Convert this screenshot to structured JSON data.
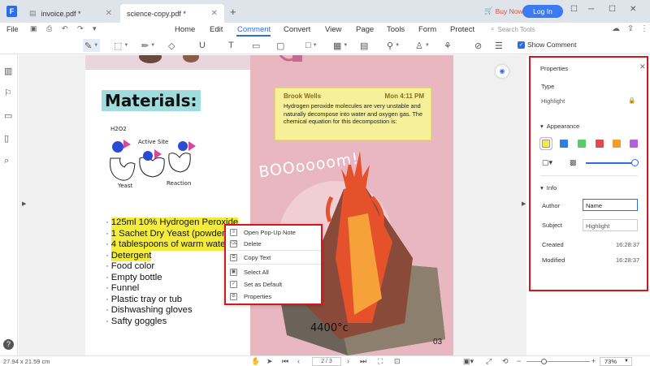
{
  "app": {
    "logo_glyph": "F"
  },
  "tabs": [
    {
      "label": "invoice.pdf *",
      "active": false
    },
    {
      "label": "science-copy.pdf *",
      "active": true
    }
  ],
  "header": {
    "buy_now": "Buy Now",
    "login": "Log In"
  },
  "menu": {
    "file": "File",
    "items": [
      "Home",
      "Edit",
      "Comment",
      "Convert",
      "View",
      "Page",
      "Tools",
      "Form",
      "Protect"
    ],
    "active": "Comment",
    "search_placeholder": "Search Tools"
  },
  "toolbar": {
    "show_comment": "Show Comment",
    "show_comment_checked": true
  },
  "document": {
    "heading": "Materials:",
    "diagram_labels": {
      "h2o2": "H2O2",
      "active_site": "Active Site",
      "yeast": "Yeast",
      "reaction": "Reaction"
    },
    "bullets": [
      {
        "text": "125ml 10% Hydrogen Peroxide",
        "highlighted": true
      },
      {
        "text": "1 Sachet Dry Yeast (powder)",
        "highlighted": true
      },
      {
        "text": "4 tablespoons of warm water",
        "highlighted": true
      },
      {
        "text": "Detergent",
        "highlighted": true
      },
      {
        "text": "Food color",
        "highlighted": false
      },
      {
        "text": "Empty bottle",
        "highlighted": false
      },
      {
        "text": "Funnel",
        "highlighted": false
      },
      {
        "text": "Plastic tray or tub",
        "highlighted": false
      },
      {
        "text": "Dishwashing gloves",
        "highlighted": false
      },
      {
        "text": "Safty goggles",
        "highlighted": false
      }
    ],
    "boom_text": "BOOoooom!",
    "temperature": "4400°c",
    "page_number": "03"
  },
  "sticky_note": {
    "author": "Brook Wells",
    "time": "Mon 4:11 PM",
    "body": "Hydrogen peroxide molecules are very unstable and naturally decompose into water and oxygen gas. The chemical equation for this decompostion is:"
  },
  "context_menu": {
    "items": [
      {
        "label": "Open Pop-Up Note",
        "icon": "note-icon"
      },
      {
        "label": "Delete",
        "icon": "trash-icon"
      },
      {
        "label": "Copy Text",
        "icon": "copy-icon"
      },
      {
        "label": "Select All",
        "icon": "select-all-icon"
      },
      {
        "label": "Set as Default",
        "icon": "checkbox-icon"
      },
      {
        "label": "Properties",
        "icon": "properties-icon"
      }
    ]
  },
  "properties": {
    "title": "Properties",
    "type_label": "Type",
    "type_value": "Highlight",
    "appearance_label": "Appearance",
    "colors": [
      "#f2e94e",
      "#2f7de1",
      "#5cc96b",
      "#e04b4b",
      "#f49b2a",
      "#b75ee0"
    ],
    "opacity": 1.0,
    "info_label": "Info",
    "author_label": "Author",
    "author_value": "Name",
    "subject_label": "Subject",
    "subject_value": "Highlight",
    "created_label": "Created",
    "created_value": "16:28:37",
    "modified_label": "Modified",
    "modified_value": "16:28:37"
  },
  "status": {
    "page_size": "27.94 x 21.59 cm",
    "page_indicator": "2 / 3",
    "zoom": "73%"
  }
}
